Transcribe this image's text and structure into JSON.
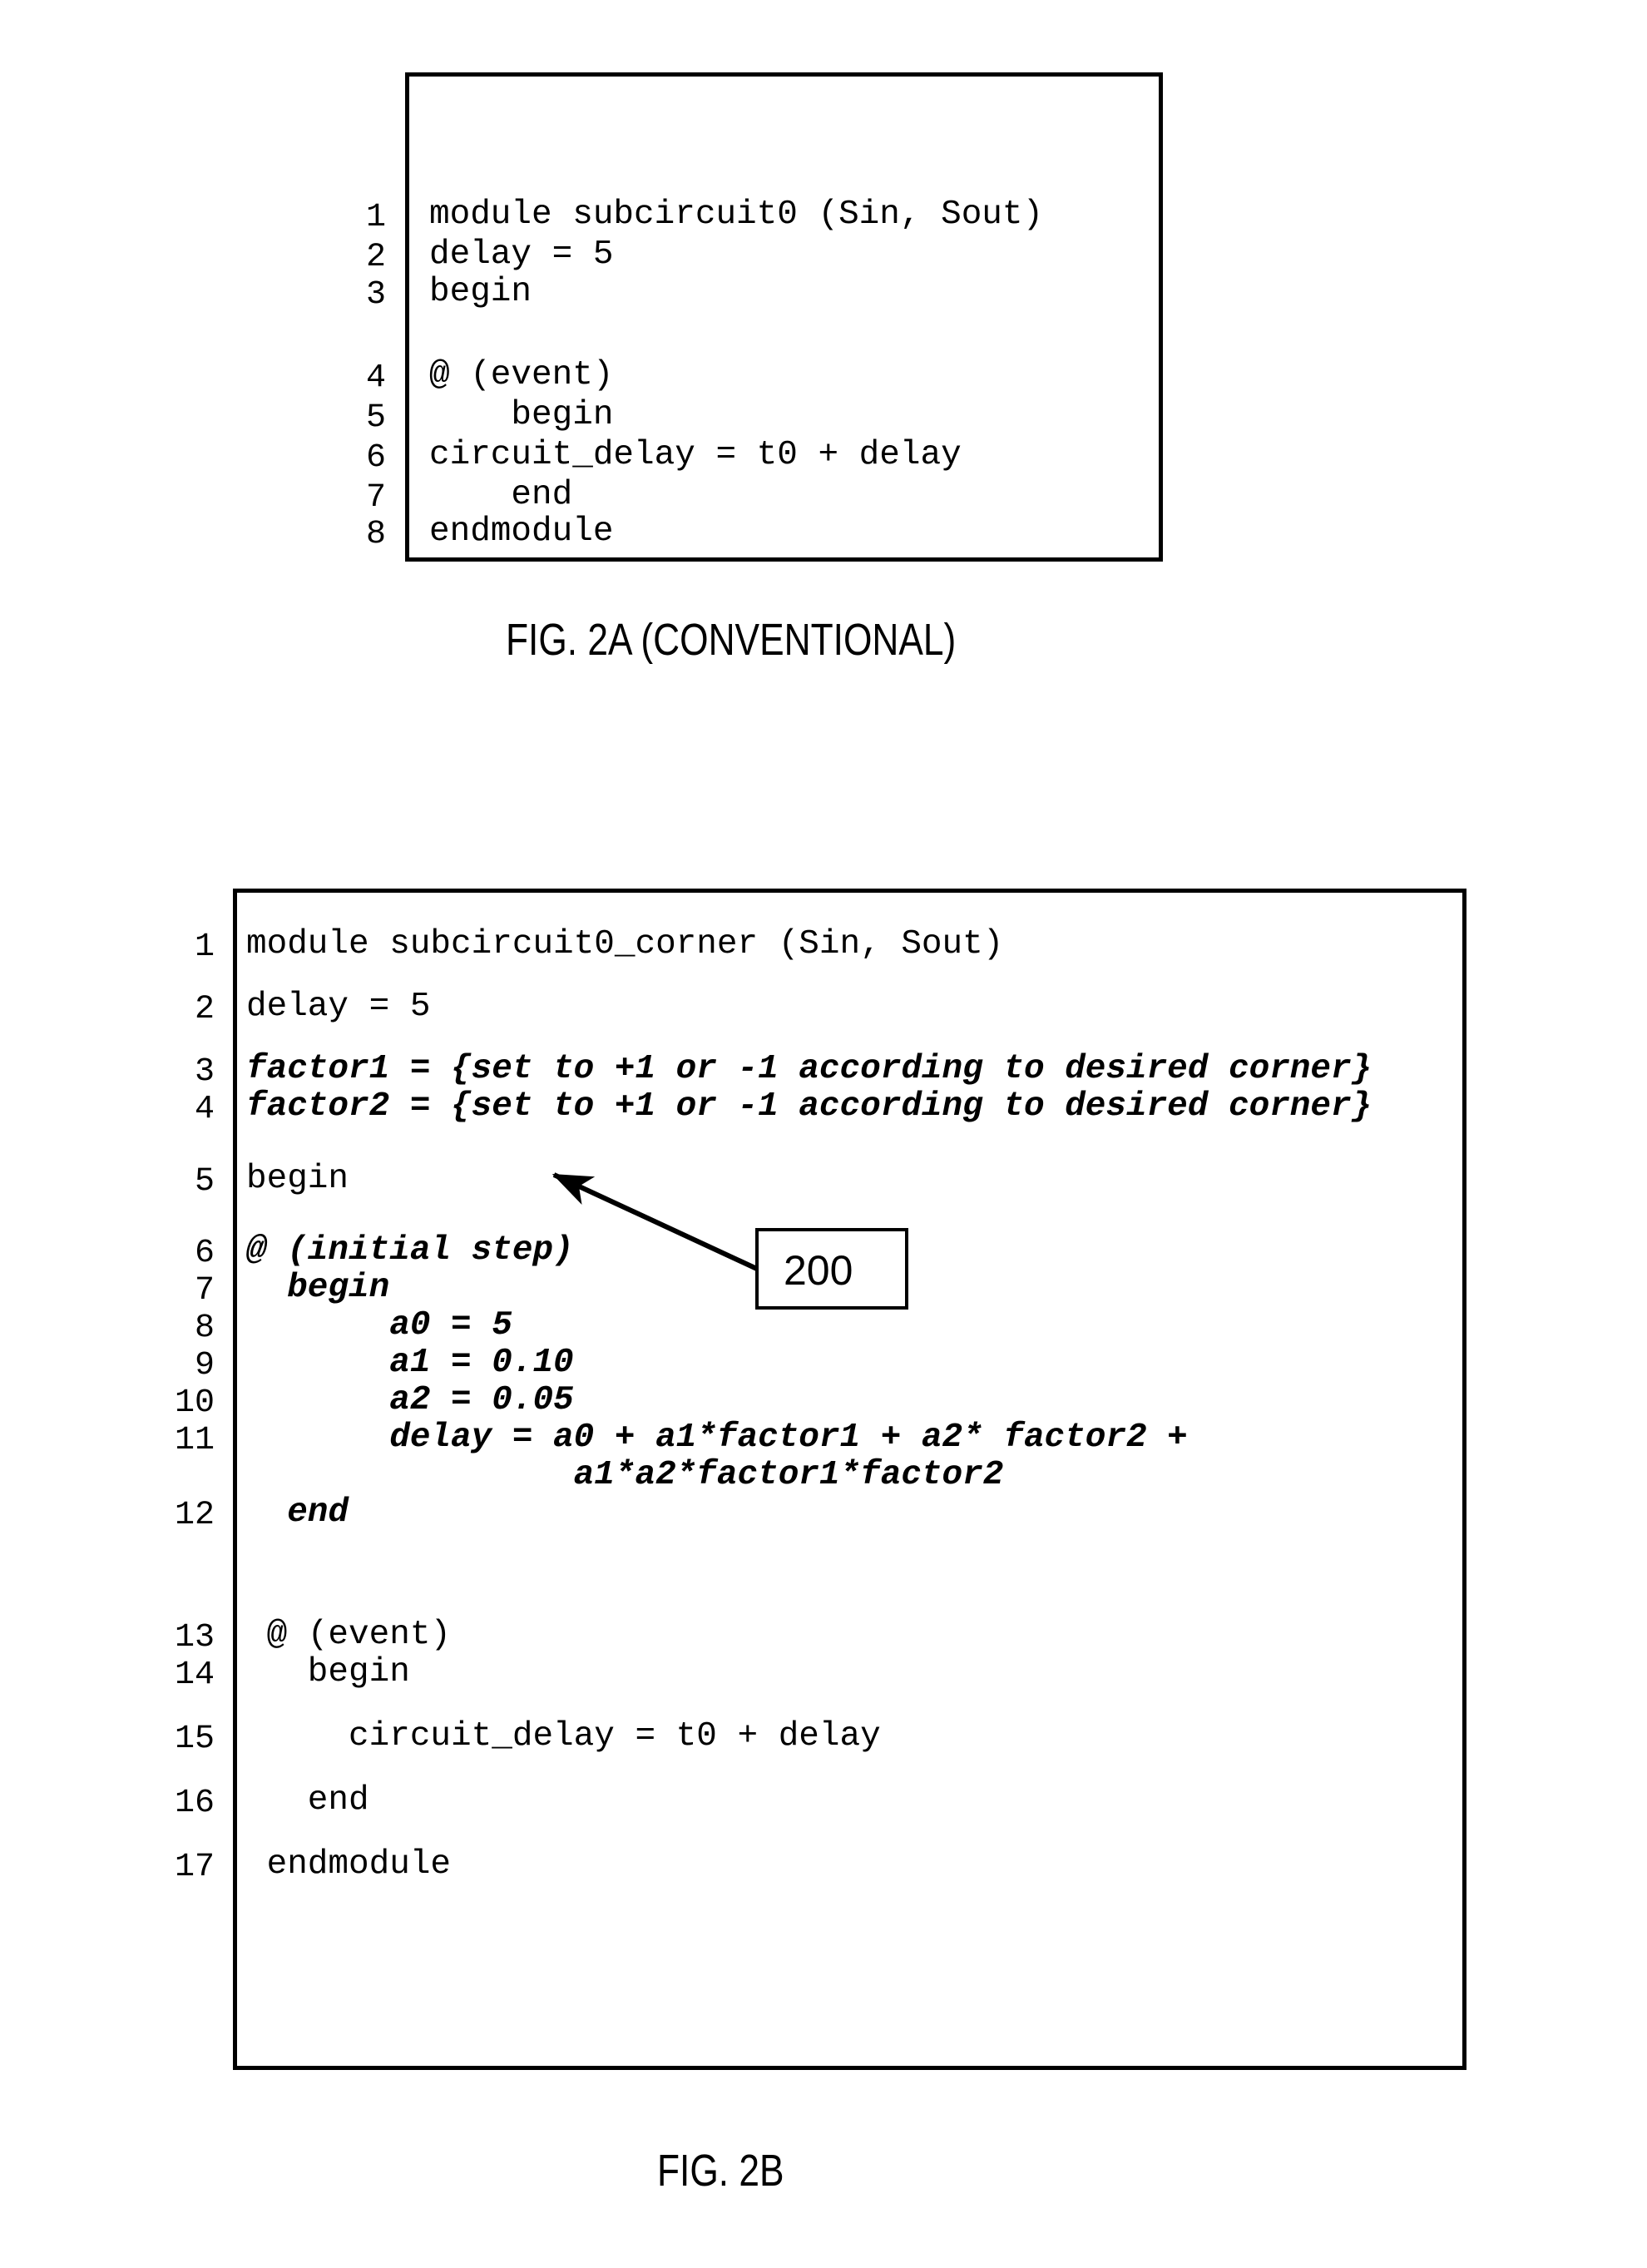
{
  "page": {
    "background": "#ffffff",
    "ink": "#000000"
  },
  "figures": [
    {
      "id": "fig2a",
      "caption": "FIG. 2A (CONVENTIONAL)",
      "line_numbers": [
        "1",
        "2",
        "3",
        "4",
        "5",
        "6",
        "7",
        "8"
      ],
      "code_lines": [
        {
          "num": "1",
          "text": "module subcircuit0 (Sin, Sout)",
          "emphasis": false
        },
        {
          "num": "2",
          "text": "delay = 5",
          "emphasis": false
        },
        {
          "num": "3",
          "text": "begin",
          "emphasis": false
        },
        {
          "num": "4",
          "text": "@ (event)",
          "emphasis": false
        },
        {
          "num": "5",
          "text": "    begin",
          "emphasis": false
        },
        {
          "num": "6",
          "text": "circuit_delay = t0 + delay",
          "emphasis": false
        },
        {
          "num": "7",
          "text": "    end",
          "emphasis": false
        },
        {
          "num": "8",
          "text": "endmodule",
          "emphasis": false
        }
      ]
    },
    {
      "id": "fig2b",
      "caption": "FIG. 2B",
      "line_numbers": [
        "1",
        "2",
        "3",
        "4",
        "5",
        "6",
        "7",
        "8",
        "9",
        "10",
        "11",
        "12",
        "13",
        "14",
        "15",
        "16",
        "17"
      ],
      "code_lines": [
        {
          "num": "1",
          "text": "module subcircuit0_corner (Sin, Sout)",
          "emphasis": false
        },
        {
          "num": "2",
          "text": "delay = 5",
          "emphasis": false
        },
        {
          "num": "3",
          "text": "factor1 = {set to +1 or -1 according to desired corner}",
          "emphasis": true
        },
        {
          "num": "4",
          "text": "factor2 = {set to +1 or -1 according to desired corner}",
          "emphasis": true
        },
        {
          "num": "5",
          "text": "begin",
          "emphasis": false
        },
        {
          "num": "6",
          "text": "@ (initial step)",
          "emphasis": true
        },
        {
          "num": "7",
          "text": "  begin",
          "emphasis": true
        },
        {
          "num": "8",
          "text": "       a0 = 5",
          "emphasis": true
        },
        {
          "num": "9",
          "text": "       a1 = 0.10",
          "emphasis": true
        },
        {
          "num": "10",
          "text": "       a2 = 0.05",
          "emphasis": true
        },
        {
          "num": "11",
          "text": "       delay = a0 + a1*factor1 + a2* factor2 +",
          "emphasis": true
        },
        {
          "num": "",
          "text": "                a1*a2*factor1*factor2",
          "emphasis": true
        },
        {
          "num": "12",
          "text": "  end",
          "emphasis": true
        },
        {
          "num": "13",
          "text": " @ (event)",
          "emphasis": false
        },
        {
          "num": "14",
          "text": "   begin",
          "emphasis": false
        },
        {
          "num": "15",
          "text": "     circuit_delay = t0 + delay",
          "emphasis": false
        },
        {
          "num": "16",
          "text": "   end",
          "emphasis": false
        },
        {
          "num": "17",
          "text": " endmodule",
          "emphasis": false
        }
      ]
    }
  ],
  "callouts": [
    {
      "id": "callout-200",
      "label": "200",
      "points_to": "factor2 line"
    }
  ]
}
